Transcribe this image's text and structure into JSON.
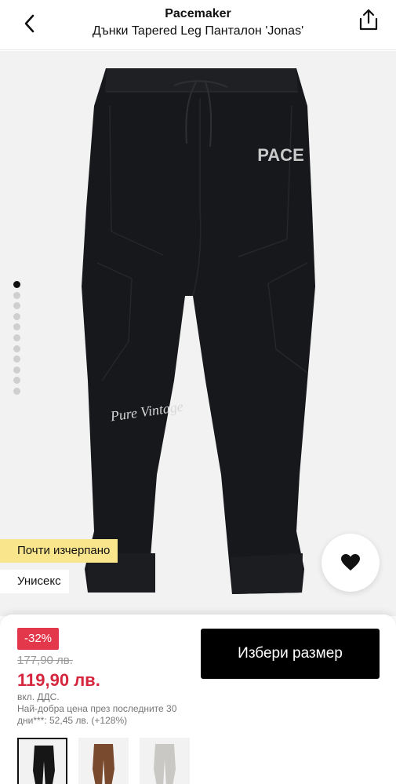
{
  "header": {
    "brand": "Pacemaker",
    "product_name": "Дънки Tapered Leg Панталон 'Jonas'",
    "back_icon": "chevron-left-icon",
    "share_icon": "share-icon"
  },
  "gallery": {
    "image_count": 11,
    "active_index": 0,
    "print_text_pace": "PACE",
    "print_text_script": "Pure Vintage",
    "badges": {
      "low_stock": "Почти изчерпано",
      "unisex": "Унисекс"
    },
    "wishlist_icon": "heart-icon"
  },
  "pricing": {
    "discount": "-32%",
    "old_price": "177,90 лв.",
    "new_price": "119,90 лв.",
    "vat_note": "вкл. ДДС.",
    "best_price_note": "Най-добра цена през последните 30 дни***: 52,45 лв. (+128%)"
  },
  "actions": {
    "select_size_label": "Избери размер"
  },
  "variants": [
    {
      "color": "black",
      "hex": "#161616",
      "selected": true
    },
    {
      "color": "brown",
      "hex": "#7a4a2e",
      "selected": false
    },
    {
      "color": "grey",
      "hex": "#c9c8c4",
      "selected": false
    }
  ],
  "colors": {
    "accent_red": "#d6263d",
    "discount_bg": "#e3384b",
    "low_stock_bg": "#f8e58c",
    "primary_button": "#000000"
  }
}
